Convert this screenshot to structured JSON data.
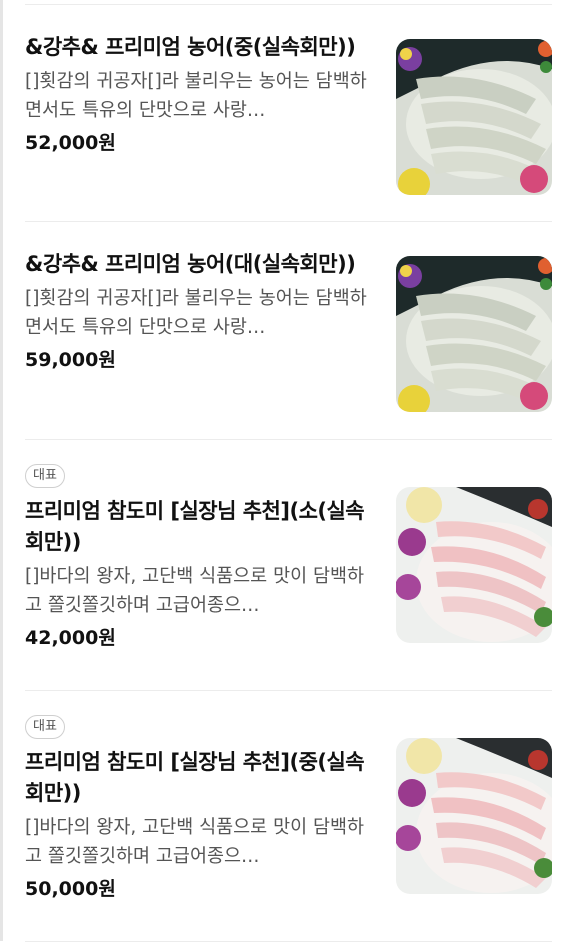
{
  "menu_items": [
    {
      "badge": "",
      "title": "&강추& 프리미엄 농어(중(실속회만))",
      "desc": "[]횟감의 귀공자[]라 불리우는 농어는 담백하면서도 특유의 단맛으로 사랑…",
      "price": "52,000원",
      "image_icon": "sliced-sea-bass-sashimi-photo"
    },
    {
      "badge": "",
      "title": "&강추& 프리미엄 농어(대(실속회만))",
      "desc": "[]횟감의 귀공자[]라 불리우는 농어는 담백하면서도 특유의 단맛으로 사랑…",
      "price": "59,000원",
      "image_icon": "sliced-sea-bass-sashimi-photo"
    },
    {
      "badge": "대표",
      "title": "프리미엄 참도미 [실장님 추천](소(실속회만))",
      "desc": "[]바다의 왕자, 고단백 식품으로 맛이 담백하고 쫄깃쫄깃하며 고급어종으…",
      "price": "42,000원",
      "image_icon": "sliced-red-seabream-sashimi-photo"
    },
    {
      "badge": "대표",
      "title": "프리미엄 참도미 [실장님 추천](중(실속회만))",
      "desc": "[]바다의 왕자, 고단백 식품으로 맛이 담백하고 쫄깃쫄깃하며 고급어종으…",
      "price": "50,000원",
      "image_icon": "sliced-red-seabream-sashimi-photo"
    }
  ]
}
